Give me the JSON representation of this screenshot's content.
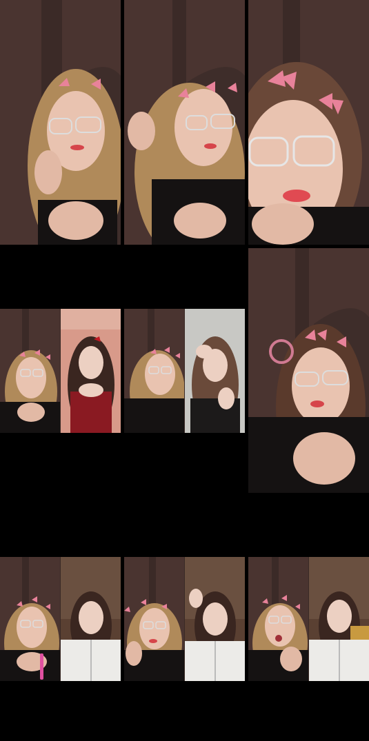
{
  "collage": {
    "background": "#000000",
    "tiles": [
      {
        "kind": "single"
      },
      {
        "kind": "single"
      },
      {
        "kind": "single"
      },
      {
        "kind": "single"
      },
      {
        "kind": "split"
      },
      {
        "kind": "split"
      },
      {
        "kind": "split"
      },
      {
        "kind": "split"
      },
      {
        "kind": "split"
      }
    ]
  },
  "colors": {
    "door": "#4a3430",
    "skin": "#e9c3b0",
    "hair_blonde": "#b08a5a",
    "hair_dark": "#3a2620",
    "butterfly": "#e8829a",
    "outfit_black": "#151212",
    "outfit_red": "#8a1a22",
    "outfit_white": "#ecebe8",
    "room_pink": "#d89a8a",
    "room_grey": "#c8c8c4",
    "room_brown": "#5a4032"
  }
}
